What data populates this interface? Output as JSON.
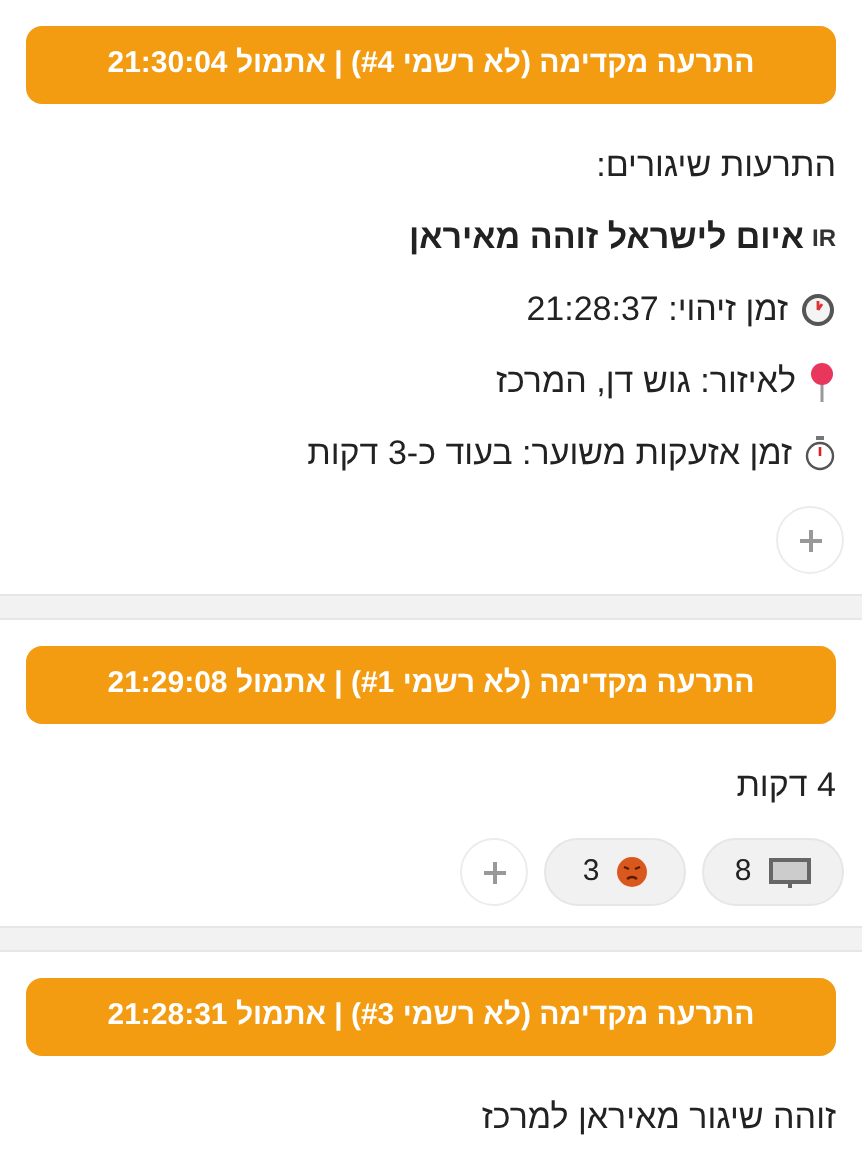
{
  "messages": [
    {
      "header": "התרעה מקדימה (לא רשמי #4) | אתמול 21:30:04",
      "lines": [
        {
          "kind": "text",
          "text": "התרעות שיגורים:"
        },
        {
          "kind": "title",
          "flag": "IR",
          "text": "איום לישראל זוהה מאיראן"
        },
        {
          "kind": "time",
          "text": "זמן זיהוי: 21:28:37"
        },
        {
          "kind": "area",
          "text": "לאיזור: גוש דן, המרכז"
        },
        {
          "kind": "eta",
          "text": "זמן אזעקות משוער: בעוד כ-3 דקות"
        }
      ],
      "add_reaction_button": true
    },
    {
      "header": "התרעה מקדימה (לא רשמי #1) | אתמול 21:29:08",
      "lines": [
        {
          "kind": "text",
          "text": "4 דקות"
        }
      ],
      "reactions": [
        {
          "kind": "screen",
          "count": "8"
        },
        {
          "kind": "angry",
          "count": "3"
        }
      ],
      "add_reaction_button": true
    },
    {
      "header": "התרעה מקדימה (לא רשמי #3) | אתמול 21:28:31",
      "lines": [
        {
          "kind": "text",
          "text": "זוהה שיגור מאיראן למרכז"
        }
      ]
    }
  ]
}
